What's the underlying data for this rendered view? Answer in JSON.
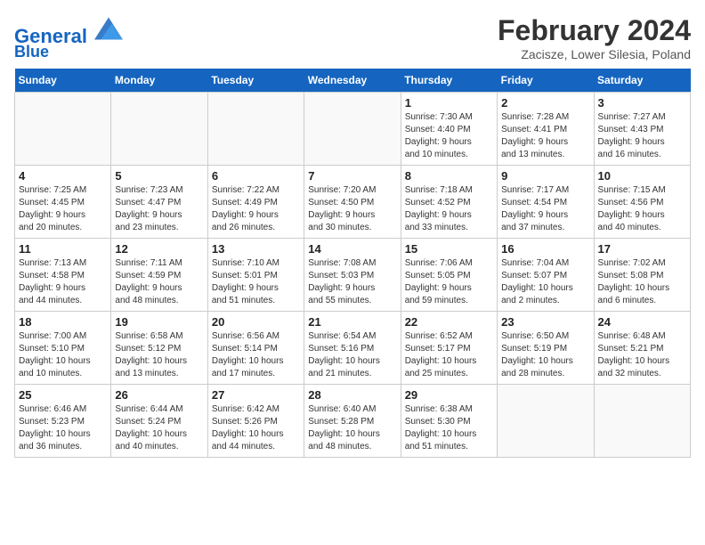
{
  "header": {
    "logo_line1": "General",
    "logo_line2": "Blue",
    "month_title": "February 2024",
    "location": "Zacisze, Lower Silesia, Poland"
  },
  "weekdays": [
    "Sunday",
    "Monday",
    "Tuesday",
    "Wednesday",
    "Thursday",
    "Friday",
    "Saturday"
  ],
  "weeks": [
    [
      {
        "day": "",
        "detail": ""
      },
      {
        "day": "",
        "detail": ""
      },
      {
        "day": "",
        "detail": ""
      },
      {
        "day": "",
        "detail": ""
      },
      {
        "day": "1",
        "detail": "Sunrise: 7:30 AM\nSunset: 4:40 PM\nDaylight: 9 hours\nand 10 minutes."
      },
      {
        "day": "2",
        "detail": "Sunrise: 7:28 AM\nSunset: 4:41 PM\nDaylight: 9 hours\nand 13 minutes."
      },
      {
        "day": "3",
        "detail": "Sunrise: 7:27 AM\nSunset: 4:43 PM\nDaylight: 9 hours\nand 16 minutes."
      }
    ],
    [
      {
        "day": "4",
        "detail": "Sunrise: 7:25 AM\nSunset: 4:45 PM\nDaylight: 9 hours\nand 20 minutes."
      },
      {
        "day": "5",
        "detail": "Sunrise: 7:23 AM\nSunset: 4:47 PM\nDaylight: 9 hours\nand 23 minutes."
      },
      {
        "day": "6",
        "detail": "Sunrise: 7:22 AM\nSunset: 4:49 PM\nDaylight: 9 hours\nand 26 minutes."
      },
      {
        "day": "7",
        "detail": "Sunrise: 7:20 AM\nSunset: 4:50 PM\nDaylight: 9 hours\nand 30 minutes."
      },
      {
        "day": "8",
        "detail": "Sunrise: 7:18 AM\nSunset: 4:52 PM\nDaylight: 9 hours\nand 33 minutes."
      },
      {
        "day": "9",
        "detail": "Sunrise: 7:17 AM\nSunset: 4:54 PM\nDaylight: 9 hours\nand 37 minutes."
      },
      {
        "day": "10",
        "detail": "Sunrise: 7:15 AM\nSunset: 4:56 PM\nDaylight: 9 hours\nand 40 minutes."
      }
    ],
    [
      {
        "day": "11",
        "detail": "Sunrise: 7:13 AM\nSunset: 4:58 PM\nDaylight: 9 hours\nand 44 minutes."
      },
      {
        "day": "12",
        "detail": "Sunrise: 7:11 AM\nSunset: 4:59 PM\nDaylight: 9 hours\nand 48 minutes."
      },
      {
        "day": "13",
        "detail": "Sunrise: 7:10 AM\nSunset: 5:01 PM\nDaylight: 9 hours\nand 51 minutes."
      },
      {
        "day": "14",
        "detail": "Sunrise: 7:08 AM\nSunset: 5:03 PM\nDaylight: 9 hours\nand 55 minutes."
      },
      {
        "day": "15",
        "detail": "Sunrise: 7:06 AM\nSunset: 5:05 PM\nDaylight: 9 hours\nand 59 minutes."
      },
      {
        "day": "16",
        "detail": "Sunrise: 7:04 AM\nSunset: 5:07 PM\nDaylight: 10 hours\nand 2 minutes."
      },
      {
        "day": "17",
        "detail": "Sunrise: 7:02 AM\nSunset: 5:08 PM\nDaylight: 10 hours\nand 6 minutes."
      }
    ],
    [
      {
        "day": "18",
        "detail": "Sunrise: 7:00 AM\nSunset: 5:10 PM\nDaylight: 10 hours\nand 10 minutes."
      },
      {
        "day": "19",
        "detail": "Sunrise: 6:58 AM\nSunset: 5:12 PM\nDaylight: 10 hours\nand 13 minutes."
      },
      {
        "day": "20",
        "detail": "Sunrise: 6:56 AM\nSunset: 5:14 PM\nDaylight: 10 hours\nand 17 minutes."
      },
      {
        "day": "21",
        "detail": "Sunrise: 6:54 AM\nSunset: 5:16 PM\nDaylight: 10 hours\nand 21 minutes."
      },
      {
        "day": "22",
        "detail": "Sunrise: 6:52 AM\nSunset: 5:17 PM\nDaylight: 10 hours\nand 25 minutes."
      },
      {
        "day": "23",
        "detail": "Sunrise: 6:50 AM\nSunset: 5:19 PM\nDaylight: 10 hours\nand 28 minutes."
      },
      {
        "day": "24",
        "detail": "Sunrise: 6:48 AM\nSunset: 5:21 PM\nDaylight: 10 hours\nand 32 minutes."
      }
    ],
    [
      {
        "day": "25",
        "detail": "Sunrise: 6:46 AM\nSunset: 5:23 PM\nDaylight: 10 hours\nand 36 minutes."
      },
      {
        "day": "26",
        "detail": "Sunrise: 6:44 AM\nSunset: 5:24 PM\nDaylight: 10 hours\nand 40 minutes."
      },
      {
        "day": "27",
        "detail": "Sunrise: 6:42 AM\nSunset: 5:26 PM\nDaylight: 10 hours\nand 44 minutes."
      },
      {
        "day": "28",
        "detail": "Sunrise: 6:40 AM\nSunset: 5:28 PM\nDaylight: 10 hours\nand 48 minutes."
      },
      {
        "day": "29",
        "detail": "Sunrise: 6:38 AM\nSunset: 5:30 PM\nDaylight: 10 hours\nand 51 minutes."
      },
      {
        "day": "",
        "detail": ""
      },
      {
        "day": "",
        "detail": ""
      }
    ]
  ]
}
